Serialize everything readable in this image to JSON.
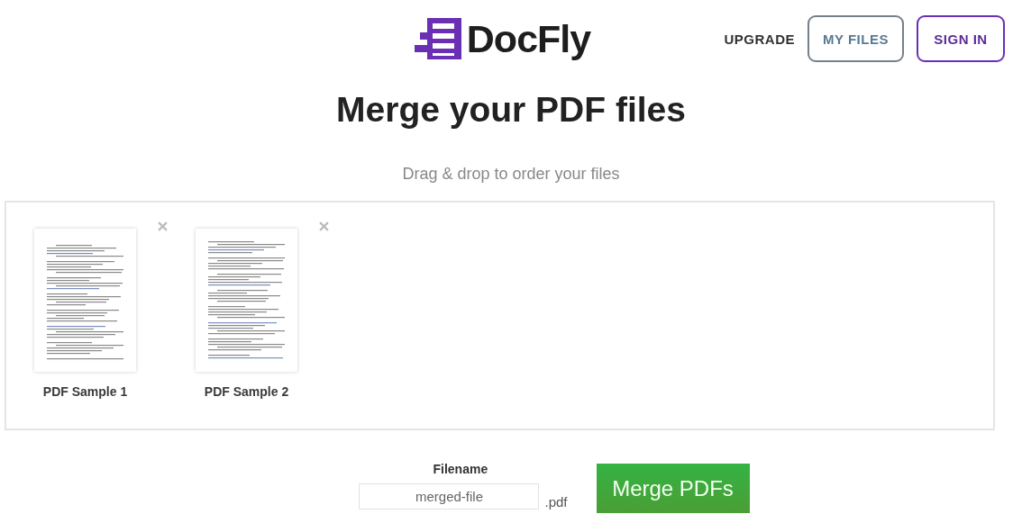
{
  "header": {
    "logo": "DocFly",
    "nav": [
      {
        "kind": "link",
        "label": "UPGRADE"
      },
      {
        "kind": "outline",
        "label": "MY FILES"
      },
      {
        "kind": "accent",
        "label": "SIGN IN"
      }
    ]
  },
  "title": "Merge your PDF files",
  "subtitle": "Drag & drop to order your files",
  "files": [
    {
      "name": "PDF Sample 1"
    },
    {
      "name": "PDF Sample 2"
    }
  ],
  "filename": {
    "label": "Filename",
    "value": "merged-file",
    "extension": ".pdf"
  },
  "merge_button": "Merge PDFs"
}
